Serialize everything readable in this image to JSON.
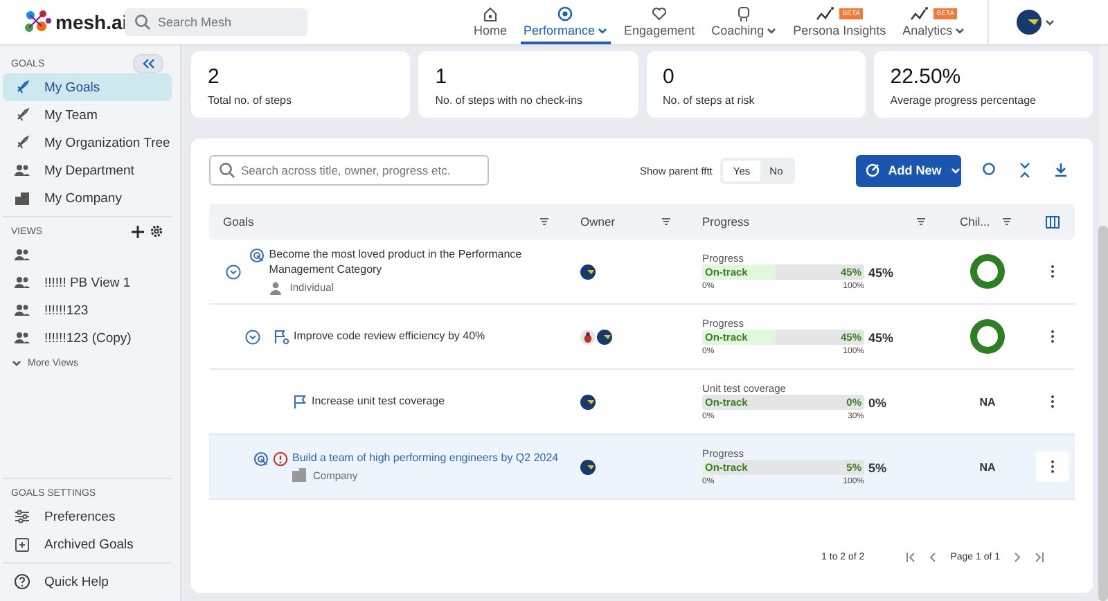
{
  "topbar": {
    "logo": "mesh.ai",
    "search": {
      "placeholder": "Search Mesh"
    },
    "nav_items": [
      {
        "label": "Home",
        "selected": false,
        "dropdown": false
      },
      {
        "label": "Performance",
        "selected": true,
        "dropdown": true
      },
      {
        "label": "Engagement",
        "selected": false,
        "dropdown": false
      },
      {
        "label": "Coaching",
        "selected": false,
        "dropdown": true
      },
      {
        "label": "Persona Insights",
        "badge": "BETA",
        "selected": false,
        "dropdown": false
      },
      {
        "label": "Analytics",
        "badge": "BETA",
        "selected": false,
        "dropdown": true
      }
    ]
  },
  "sidebar": {
    "goals": {
      "heading": "GOALS",
      "items": [
        {
          "label": "My Goals",
          "selected": true
        },
        {
          "label": "My Team",
          "selected": false
        },
        {
          "label": "My Organization Tree",
          "selected": false
        },
        {
          "label": "My Department",
          "selected": false
        },
        {
          "label": "My Company",
          "selected": false
        }
      ]
    },
    "views": {
      "heading": "VIEWS",
      "items": [
        {
          "kind": "unnamed"
        },
        {
          "kind": "named",
          "label": "!!!!!! PB View 1"
        },
        {
          "kind": "named",
          "label": "!!!!!!123"
        },
        {
          "kind": "named",
          "label": "!!!!!!123 (Copy)"
        }
      ],
      "more": "More Views"
    },
    "settings": {
      "heading": "GOALS SETTINGS",
      "items": [
        "Preferences",
        "Archived Goals"
      ]
    },
    "help": "Quick Help"
  },
  "stats": [
    {
      "value": "2",
      "label": "Total no. of steps"
    },
    {
      "value": "1",
      "label": "No. of steps with no check-ins"
    },
    {
      "value": "0",
      "label": "No. of steps at risk"
    },
    {
      "value": "22.50%",
      "label": "Average progress percentage"
    }
  ],
  "toolbar": {
    "search": {
      "placeholder": "Search across title, owner, progress etc."
    },
    "parent_label": "Show parent fftt",
    "toggle": [
      {
        "label": "Yes",
        "selected": true
      },
      {
        "label": "No",
        "selected": false
      }
    ],
    "add_button": "Add New"
  },
  "table": {
    "columns": [
      "Goals",
      "Owner",
      "Progress",
      "Chil..."
    ],
    "rows": [
      {
        "title": "Become the most loved product in the Performance Management Category",
        "warning": false,
        "selected": false,
        "expanded": true,
        "category": {
          "kind": "person",
          "label": "Individual"
        },
        "owners": [
          {
            "kind": "globe"
          }
        ],
        "progress": {
          "label": "Progress",
          "status": "On-track",
          "level": 0.45,
          "inner": "45%",
          "value": "45%",
          "min": "0%",
          "max": "100%"
        },
        "children_cell": {
          "kind": "donut"
        },
        "children": [
          {
            "title": "Improve code review efficiency by 40%",
            "warning": false,
            "selected": false,
            "expanded": true,
            "owners": [
              {
                "kind": "bug"
              },
              {
                "kind": "globe"
              }
            ],
            "progress": {
              "label": "Progress",
              "status": "On-track",
              "level": 0.45,
              "inner": "45%",
              "value": "45%",
              "min": "0%",
              "max": "100%"
            },
            "children_cell": {
              "kind": "donut"
            },
            "children": [
              {
                "title": "Increase unit test coverage",
                "warning": false,
                "selected": false,
                "owners": [
                  {
                    "kind": "globe"
                  }
                ],
                "progress": {
                  "label": "Unit test coverage",
                  "status": "On-track",
                  "level": 0,
                  "inner": "0%",
                  "value": "0%",
                  "min": "0%",
                  "max": "30%"
                },
                "children_cell": {
                  "kind": "text",
                  "text": "NA"
                }
              }
            ]
          }
        ]
      },
      {
        "title": "Build a team of high performing engineers by Q2 2024",
        "warning": true,
        "selected": true,
        "category": {
          "kind": "company",
          "label": "Company"
        },
        "owners": [
          {
            "kind": "globe"
          }
        ],
        "progress": {
          "label": "Progress",
          "status": "On-track",
          "level": 0.05,
          "inner": "5%",
          "value": "5%",
          "min": "0%",
          "max": "100%"
        },
        "children_cell": {
          "kind": "text",
          "text": "NA"
        }
      }
    ]
  },
  "pagination": {
    "range": "1 to 2 of 2",
    "page": "Page 1 of 1"
  }
}
